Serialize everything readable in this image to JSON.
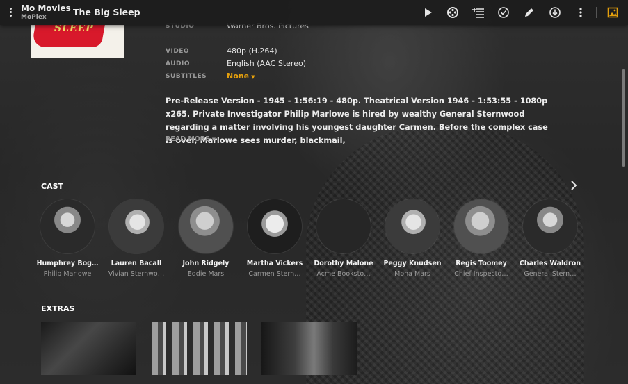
{
  "app": {
    "library": "Mo Movies",
    "server": "MoPlex",
    "title": "The Big Sleep"
  },
  "toolbar": {
    "icons": [
      "play-icon",
      "trailer-reel-icon",
      "add-to-playlist-icon",
      "mark-watched-icon",
      "edit-pencil-icon",
      "download-icon",
      "more-vertical-icon",
      "image-icon"
    ],
    "accent": "#e5a00d"
  },
  "poster": {
    "text": "SLEEP"
  },
  "meta": {
    "studio_label": "STUDIO",
    "studio": "Warner Bros. Pictures",
    "video_label": "VIDEO",
    "video": "480p (H.264)",
    "audio_label": "AUDIO",
    "audio": "English (AAC Stereo)",
    "subtitles_label": "SUBTITLES",
    "subtitles": "None"
  },
  "summary": "Pre-Release Version - 1945 - 1:56:19 - 480p. Theatrical Version 1946 - 1:53:55 - 1080p x265. Private Investigator Philip Marlowe is hired by wealthy General Sternwood regarding a matter involving his youngest daughter Carmen. Before the complex case is over, Marlowe sees murder, blackmail,",
  "read_more": "READ MORE",
  "cast_title": "CAST",
  "cast": [
    {
      "name": "Humphrey Bog…",
      "role": "Philip Marlowe"
    },
    {
      "name": "Lauren Bacall",
      "role": "Vivian Sternwo…"
    },
    {
      "name": "John Ridgely",
      "role": "Eddie Mars"
    },
    {
      "name": "Martha Vickers",
      "role": "Carmen Stern…"
    },
    {
      "name": "Dorothy Malone",
      "role": "Acme Booksto…"
    },
    {
      "name": "Peggy Knudsen",
      "role": "Mona Mars"
    },
    {
      "name": "Regis Toomey",
      "role": "Chief Inspecto…"
    },
    {
      "name": "Charles Waldron",
      "role": "General Stern…"
    }
  ],
  "extras_title": "EXTRAS"
}
